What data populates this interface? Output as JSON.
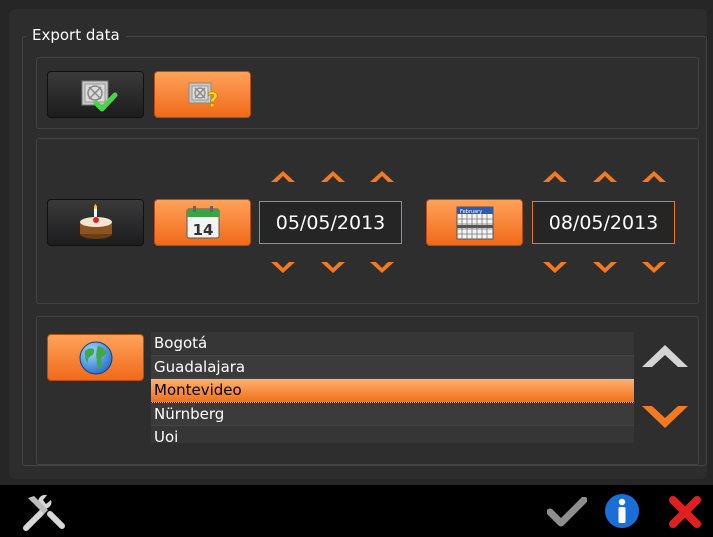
{
  "dialog": {
    "title": "Export data"
  },
  "export_mode": {
    "check_icon": "drive-check-icon",
    "question_icon": "drive-question-icon"
  },
  "date_range": {
    "birthday_icon": "cake-icon",
    "start_calendar_day": "14",
    "start_date": "05/05/2013",
    "end_calendar_month": "February",
    "end_date": "08/05/2013"
  },
  "location": {
    "globe_icon": "globe-icon",
    "cities": [
      "Bogotá",
      "Guadalajara",
      "Montevideo",
      "Nürnberg",
      "Uoi"
    ],
    "selected_city": "Montevideo"
  },
  "footer": {
    "tools_icon": "tools-icon",
    "confirm_icon": "checkmark-icon",
    "info_icon": "info-icon",
    "close_icon": "close-icon"
  },
  "colors": {
    "accent_orange": "#f47a22",
    "background": "#2d2d2d",
    "field_border": "#e8781e",
    "close_red": "#e02020",
    "info_blue": "#1a6fd6"
  }
}
